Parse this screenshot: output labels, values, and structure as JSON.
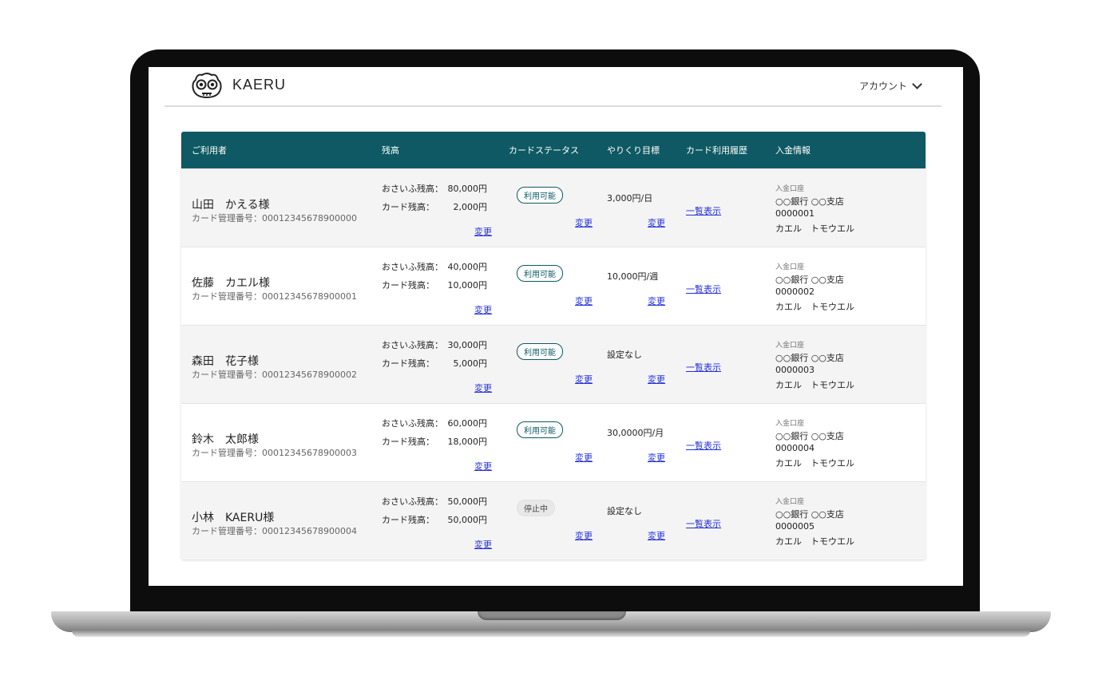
{
  "header": {
    "brand": "KAERU",
    "account_label": "アカウント"
  },
  "table": {
    "columns": [
      "ご利用者",
      "残高",
      "カードステータス",
      "やりくり目標",
      "カード利用履歴",
      "入金情報"
    ],
    "change_label": "変更",
    "history_label": "一覧表示",
    "wallet_label": "おさいふ残高：",
    "card_label": "カード残高：",
    "deposit_label": "入金口座",
    "rows": [
      {
        "name": "山田　かえる様",
        "card_id": "カード管理番号：00012345678900000",
        "wallet": "80,000円",
        "card": "2,000円",
        "status": "利用可能",
        "goal": "3,000円/日",
        "bank": "○○銀行 ○○支店",
        "account_no": "0000001",
        "holder": "カエル　トモウエル"
      },
      {
        "name": "佐藤　カエル様",
        "card_id": "カード管理番号：00012345678900001",
        "wallet": "40,000円",
        "card": "10,000円",
        "status": "利用可能",
        "goal": "10,000円/週",
        "bank": "○○銀行 ○○支店",
        "account_no": "0000002",
        "holder": "カエル　トモウエル"
      },
      {
        "name": "森田　花子様",
        "card_id": "カード管理番号：00012345678900002",
        "wallet": "30,000円",
        "card": "5,000円",
        "status": "利用可能",
        "goal": "設定なし",
        "bank": "○○銀行 ○○支店",
        "account_no": "0000003",
        "holder": "カエル　トモウエル"
      },
      {
        "name": "鈴木　太郎様",
        "card_id": "カード管理番号：00012345678900003",
        "wallet": "60,000円",
        "card": "18,000円",
        "status": "利用可能",
        "goal": "30,0000円/月",
        "bank": "○○銀行 ○○支店",
        "account_no": "0000004",
        "holder": "カエル　トモウエル"
      },
      {
        "name": "小林　KAERU様",
        "card_id": "カード管理番号：00012345678900004",
        "wallet": "50,000円",
        "card": "50,000円",
        "status": "停止中",
        "goal": "設定なし",
        "bank": "○○銀行 ○○支店",
        "account_no": "0000005",
        "holder": "カエル　トモウエル"
      }
    ]
  },
  "colors": {
    "header_bg": "#0e5963",
    "link": "#2330d9",
    "row_alt": "#f4f4f4"
  },
  "icons": {
    "logo": "frog-logo-icon",
    "account_menu": "chevron-down-icon"
  }
}
